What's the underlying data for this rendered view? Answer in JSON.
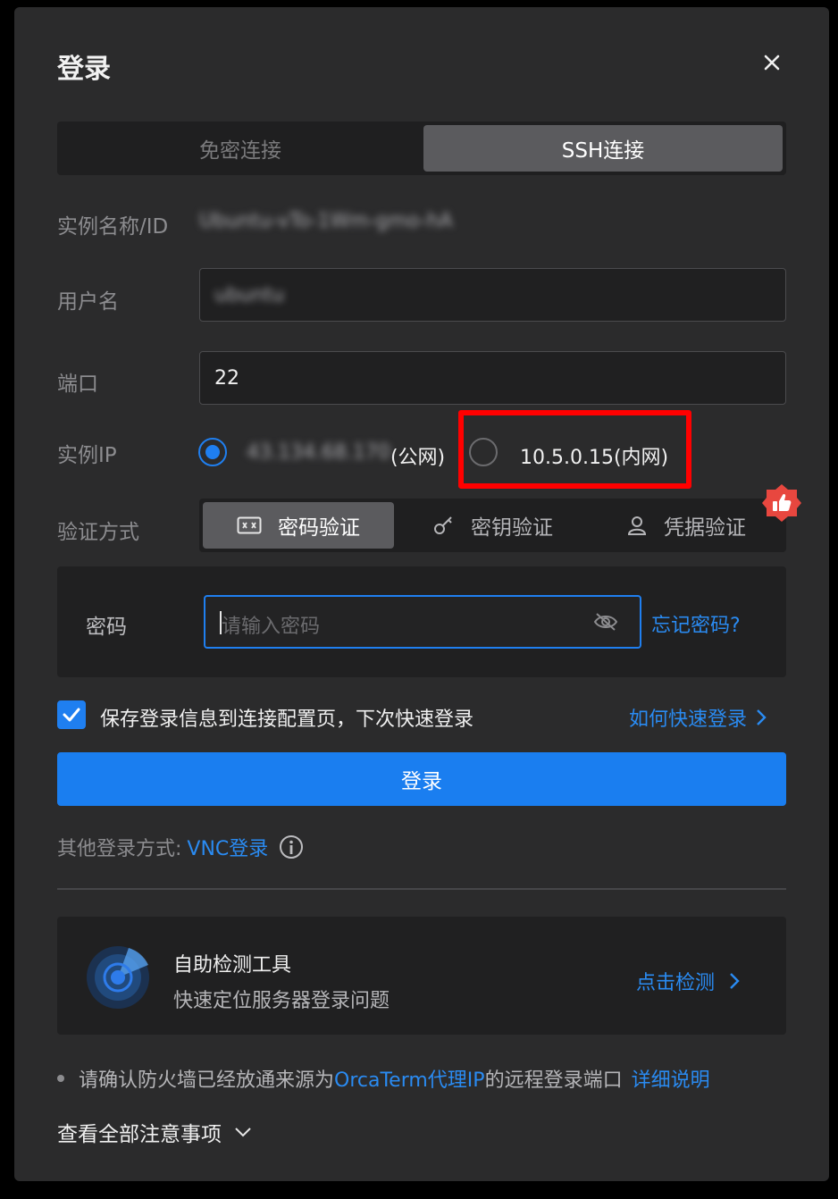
{
  "dialog": {
    "title": "登录",
    "tabs": [
      {
        "label": "免密连接",
        "active": false
      },
      {
        "label": "SSH连接",
        "active": true
      }
    ]
  },
  "form": {
    "instance_label": "实例名称/ID",
    "instance_value": "Ubuntu-vTo-1Wm-gmo-hA",
    "username_label": "用户名",
    "username_value": "ubuntu",
    "port_label": "端口",
    "port_value": "22",
    "ip_label": "实例IP",
    "ip_options": [
      {
        "ip": "43.134.68.170",
        "suffix": "(公网)",
        "selected": true
      },
      {
        "label": "10.5.0.15(内网)",
        "selected": false
      }
    ],
    "auth_label": "验证方式",
    "auth_tabs": [
      {
        "label": "密码验证",
        "icon": "password-icon",
        "active": true
      },
      {
        "label": "密钥验证",
        "icon": "key-icon",
        "active": false
      },
      {
        "label": "凭据验证",
        "icon": "user-icon",
        "active": false
      }
    ],
    "password_label": "密码",
    "password_placeholder": "请输入密码",
    "forgot_password": "忘记密码?",
    "save_info_label": "保存登录信息到连接配置页，下次快速登录",
    "save_info_checked": true,
    "quick_login_link": "如何快速登录",
    "login_button": "登录",
    "other_methods_label": "其他登录方式:",
    "vnc_link": "VNC登录"
  },
  "tool": {
    "title": "自助检测工具",
    "subtitle": "快速定位服务器登录问题",
    "action": "点击检测"
  },
  "notice": {
    "prefix": "请确认防火墙已经放通来源为",
    "link": "OrcaTerm代理IP",
    "suffix": "的远程登录端口",
    "details": "详细说明",
    "view_all": "查看全部注意事项"
  },
  "colors": {
    "accent": "#1f7ff0",
    "highlight_box": "#ff0000",
    "badge": "#e8473f"
  }
}
